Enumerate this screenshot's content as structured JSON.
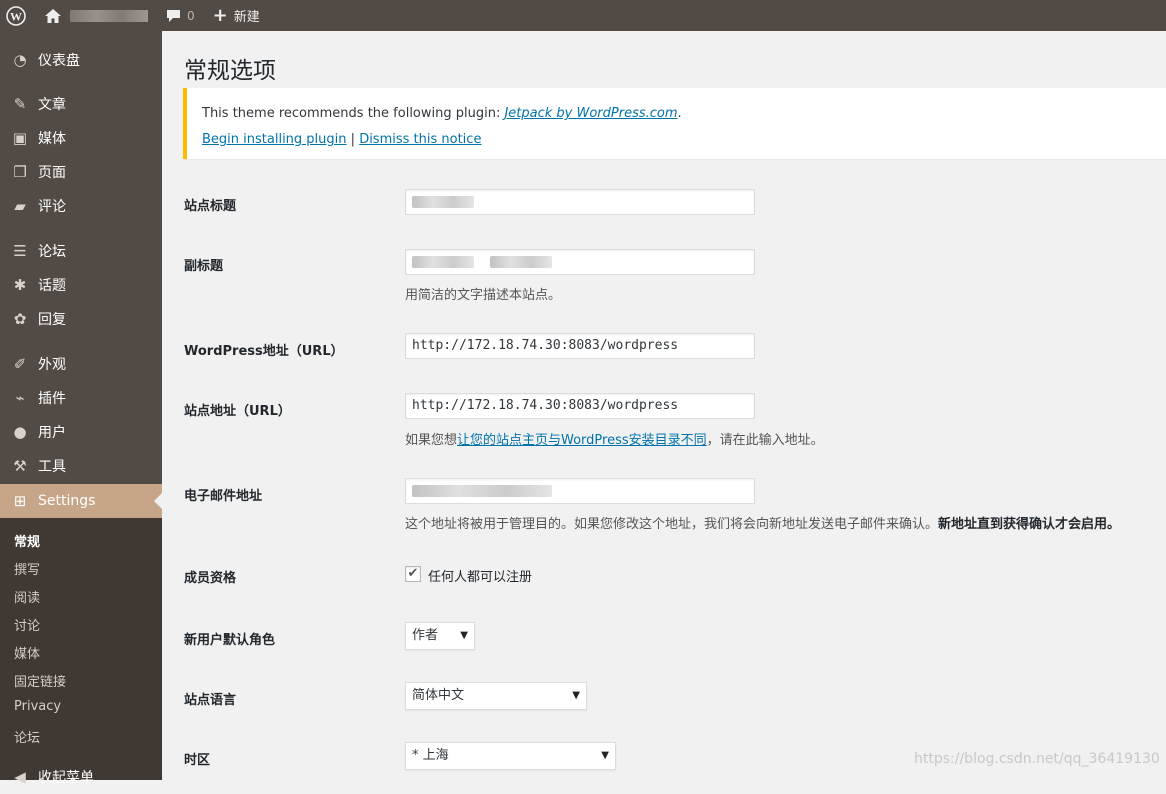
{
  "admin_bar": {
    "comment_count": "0",
    "new_label": "新建"
  },
  "sidebar": {
    "items": [
      {
        "label": "仪表盘",
        "icon": "dashboard-icon"
      },
      {
        "label": "文章",
        "icon": "pin-icon"
      },
      {
        "label": "媒体",
        "icon": "media-icon"
      },
      {
        "label": "页面",
        "icon": "page-icon"
      },
      {
        "label": "评论",
        "icon": "comment-icon"
      },
      {
        "label": "论坛",
        "icon": "forum-icon"
      },
      {
        "label": "话题",
        "icon": "topic-icon"
      },
      {
        "label": "回复",
        "icon": "reply-icon"
      },
      {
        "label": "外观",
        "icon": "appearance-icon"
      },
      {
        "label": "插件",
        "icon": "plugin-icon"
      },
      {
        "label": "用户",
        "icon": "user-icon"
      },
      {
        "label": "工具",
        "icon": "wrench-icon"
      },
      {
        "label": "Settings",
        "icon": "settings-icon"
      }
    ],
    "submenu": [
      "常规",
      "撰写",
      "阅读",
      "讨论",
      "媒体",
      "固定链接",
      "Privacy",
      "论坛"
    ],
    "collapse_label": "收起菜单"
  },
  "main": {
    "title": "常规选项",
    "notice": {
      "text": "This theme recommends the following plugin: ",
      "plugin_link": "Jetpack by WordPress.com",
      "begin_link": "Begin installing plugin",
      "separator": "|",
      "dismiss_link": "Dismiss this notice"
    },
    "fields": {
      "site_title_label": "站点标题",
      "tagline_label": "副标题",
      "tagline_desc": "用简洁的文字描述本站点。",
      "wp_url_label": "WordPress地址（URL）",
      "wp_url_value": "http://172.18.74.30:8083/wordpress",
      "site_url_label": "站点地址（URL）",
      "site_url_value": "http://172.18.74.30:8083/wordpress",
      "site_url_desc_pre": "如果您想",
      "site_url_desc_link": "让您的站点主页与WordPress安装目录不同",
      "site_url_desc_post": "，请在此输入地址。",
      "email_label": "电子邮件地址",
      "email_desc": "这个地址将被用于管理目的。如果您修改这个地址，我们将会向新地址发送电子邮件来确认。",
      "email_desc_bold": "新地址直到获得确认才会启用。",
      "membership_label": "成员资格",
      "membership_checkbox": "任何人都可以注册",
      "default_role_label": "新用户默认角色",
      "default_role_value": "作者",
      "language_label": "站点语言",
      "language_value": "简体中文",
      "timezone_label": "时区",
      "timezone_value": "* 上海"
    }
  },
  "watermark": "https://blog.csdn.net/qq_36419130"
}
